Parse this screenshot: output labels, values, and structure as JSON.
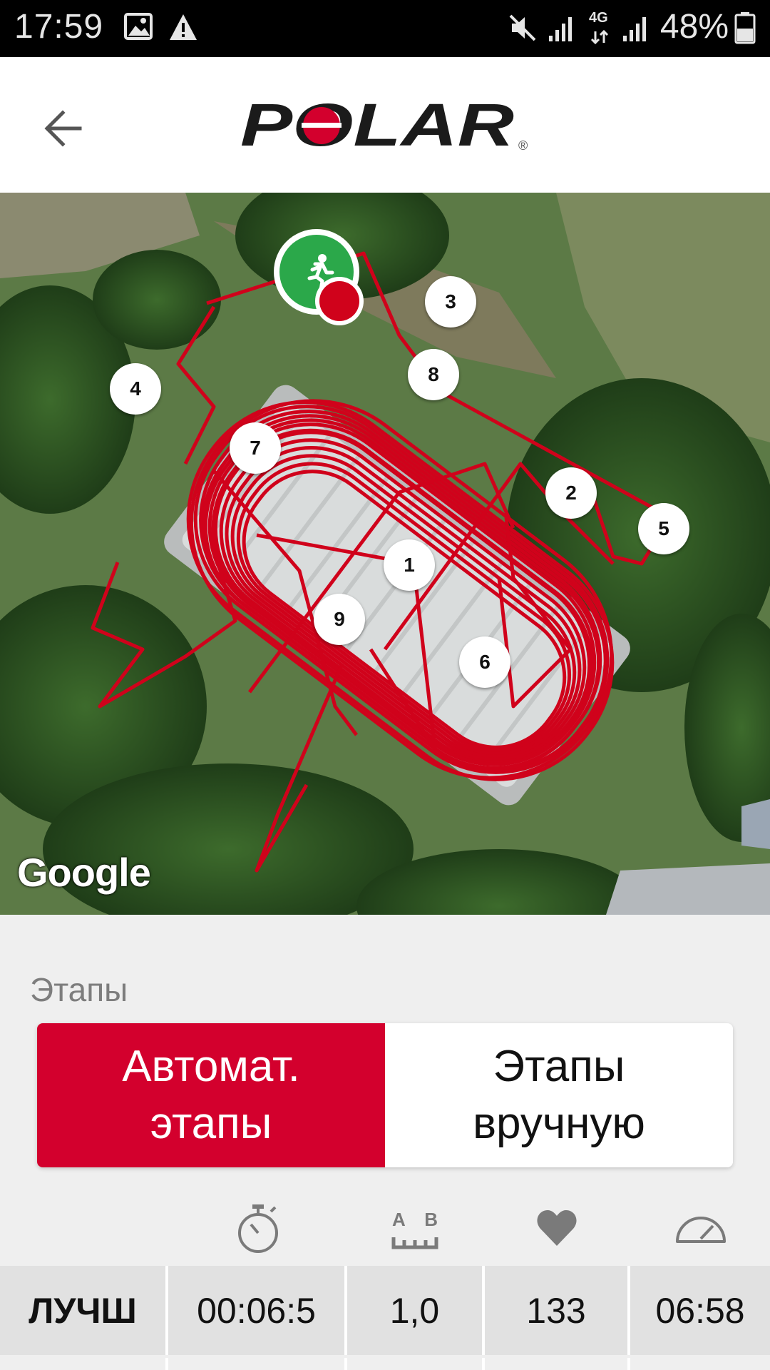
{
  "status_bar": {
    "time": "17:59",
    "network_label": "4G",
    "battery": "48%",
    "icons": [
      "image-icon",
      "warning-icon",
      "mute-icon",
      "signal-icon",
      "signal-icon",
      "battery-icon"
    ]
  },
  "header": {
    "back_icon": "arrow-left-icon",
    "logo_text": "POLAR",
    "logo_registered": "®"
  },
  "map": {
    "attribution": "Google",
    "start_icon": "runner-icon",
    "lap_markers": [
      "1",
      "2",
      "3",
      "4",
      "5",
      "6",
      "7",
      "8",
      "9"
    ],
    "route_color": "#d0021b"
  },
  "laps": {
    "section_title": "Этапы",
    "toggle": {
      "auto_label": "Автомат.\nэтапы",
      "manual_label": "Этапы\nвручную",
      "selected": "auto"
    },
    "columns": [
      {
        "icon": "stopwatch-icon"
      },
      {
        "icon": "distance-ab-icon",
        "text": "A B"
      },
      {
        "icon": "heart-icon"
      },
      {
        "icon": "speedometer-icon"
      }
    ],
    "best_row": {
      "label": "ЛУЧШ",
      "time": "00:06:5",
      "distance": "1,0",
      "heart_rate": "133",
      "pace": "06:58"
    }
  },
  "colors": {
    "accent": "#d3002d",
    "status_bar": "#000000",
    "header_bg": "#ffffff",
    "start_marker": "#2ba84a",
    "end_marker": "#d0021b"
  }
}
